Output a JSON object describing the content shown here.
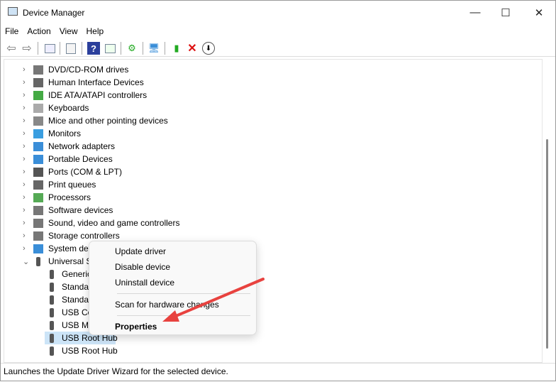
{
  "window": {
    "title": "Device Manager",
    "minimize": "—",
    "maximize": "☐",
    "close": "✕"
  },
  "menu": [
    "File",
    "Action",
    "View",
    "Help"
  ],
  "toolbar": [
    "back-icon",
    "forward-icon",
    "show-hide-console-tree-icon",
    "properties-icon",
    "help-icon",
    "action-pane-icon",
    "update-driver-icon",
    "scan-hardware-icon",
    "enable-device-icon",
    "uninstall-icon",
    "disable-device-icon"
  ],
  "tree": [
    {
      "label": "DVD/CD-ROM drives",
      "icon": "dvd-icon"
    },
    {
      "label": "Human Interface Devices",
      "icon": "hid-icon"
    },
    {
      "label": "IDE ATA/ATAPI controllers",
      "icon": "ide-icon"
    },
    {
      "label": "Keyboards",
      "icon": "keyboard-icon"
    },
    {
      "label": "Mice and other pointing devices",
      "icon": "mouse-icon"
    },
    {
      "label": "Monitors",
      "icon": "monitor-icon"
    },
    {
      "label": "Network adapters",
      "icon": "network-icon"
    },
    {
      "label": "Portable Devices",
      "icon": "portable-icon"
    },
    {
      "label": "Ports (COM & LPT)",
      "icon": "port-icon"
    },
    {
      "label": "Print queues",
      "icon": "printer-icon"
    },
    {
      "label": "Processors",
      "icon": "processor-icon"
    },
    {
      "label": "Software devices",
      "icon": "software-icon"
    },
    {
      "label": "Sound, video and game controllers",
      "icon": "sound-icon"
    },
    {
      "label": "Storage controllers",
      "icon": "storage-icon"
    },
    {
      "label": "System dev",
      "icon": "system-icon"
    },
    {
      "label": "Universal S",
      "icon": "usb-icon",
      "expanded": true
    }
  ],
  "usb_children": [
    "Generic",
    "Standar",
    "Standar",
    "USB Co",
    "USB Ma",
    "USB Root Hub",
    "USB Root Hub"
  ],
  "context_menu": {
    "update": "Update driver",
    "disable": "Disable device",
    "uninstall": "Uninstall device",
    "scan": "Scan for hardware changes",
    "properties": "Properties"
  },
  "status": "Launches the Update Driver Wizard for the selected device.",
  "colors": {
    "selection": "#cce4f7",
    "arrow": "#e8423f"
  }
}
